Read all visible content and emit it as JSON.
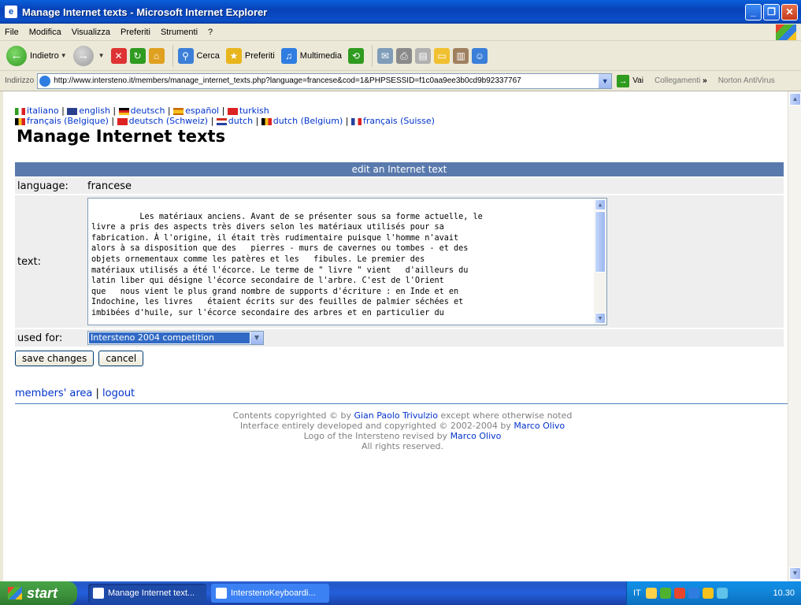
{
  "window": {
    "title": "Manage Internet texts - Microsoft Internet Explorer"
  },
  "menu": [
    "File",
    "Modifica",
    "Visualizza",
    "Preferiti",
    "Strumenti",
    "?"
  ],
  "toolbar": {
    "back": "Indietro",
    "search": "Cerca",
    "favorites": "Preferiti",
    "media": "Multimedia"
  },
  "address": {
    "label": "Indirizzo",
    "url": "http://www.intersteno.it/members/manage_internet_texts.php?language=francese&cod=1&PHPSESSID=f1c0aa9ee3b0cd9b92337767",
    "go": "Vai",
    "links": "Collegamenti",
    "extra": "Norton AntiVirus"
  },
  "languages": {
    "line1": [
      "italiano",
      "english",
      "deutsch",
      "español",
      "turkish"
    ],
    "line2": [
      "français (Belgique)",
      "deutsch (Schweiz)",
      "dutch",
      "dutch (Belgium)",
      "français (Suisse)"
    ]
  },
  "page": {
    "title": "Manage Internet texts",
    "form_header": "edit an Internet text",
    "language_label": "language:",
    "language_value": "francese",
    "text_label": "text:",
    "text_value": "Les matériaux anciens. Avant de se présenter sous sa forme actuelle, le\nlivre a pris des aspects très divers selon les matériaux utilisés pour sa\nfabrication. À l'origine, il était très rudimentaire puisque l'homme n'avait\nalors à sa disposition que des   pierres - murs de cavernes ou tombes - et des\nobjets ornementaux comme les patères et les   fibules. Le premier des\nmatériaux utilisés a été l'écorce. Le terme de \" livre \" vient   d'ailleurs du\nlatin liber qui désigne l'écorce secondaire de l'arbre. C'est de l'Orient\nque   nous vient le plus grand nombre de supports d'écriture : en Inde et en\nIndochine, les livres   étaient écrits sur des feuilles de palmier séchées et\nimbibées d'huile, sur l'écorce secondaire des arbres et en particulier du",
    "used_for_label": "used for:",
    "used_for_value": "Intersteno 2004 competition",
    "save_button": "save changes",
    "cancel_button": "cancel",
    "members_area": "members' area",
    "logout": "logout"
  },
  "copyright": {
    "line1_pre": "Contents copyrighted © by ",
    "line1_link": "Gian Paolo Trivulzio",
    "line1_post": " except where otherwise noted",
    "line2_pre": "Interface entirely developed and copyrighted © 2002-2004 by ",
    "line2_link": "Marco Olivo",
    "line3_pre": "Logo of the Intersteno revised by ",
    "line3_link": "Marco Olivo",
    "line4": "All rights reserved."
  },
  "taskbar": {
    "start": "start",
    "tasks": [
      "Manage Internet text...",
      "InterstenoKeyboardi..."
    ],
    "lang": "IT",
    "clock": "10.30"
  }
}
